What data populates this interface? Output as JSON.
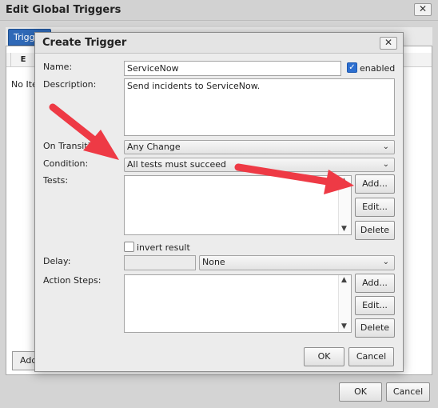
{
  "outer": {
    "title": "Edit Global Triggers",
    "tab_label": "Triggers",
    "column_header": "E",
    "empty_text": "No Items",
    "add_label": "Add",
    "ok_label": "OK",
    "cancel_label": "Cancel"
  },
  "dialog": {
    "title": "Create Trigger",
    "name_label": "Name:",
    "name_value": "ServiceNow",
    "enabled_label": "enabled",
    "enabled_checked": true,
    "description_label": "Description:",
    "description_value": "Send incidents to ServiceNow.",
    "on_transition_label": "On Transition:",
    "on_transition_value": "Any Change",
    "condition_label": "Condition:",
    "condition_value": "All tests must succeed",
    "tests_label": "Tests:",
    "tests_add": "Add...",
    "tests_edit": "Edit...",
    "tests_delete": "Delete",
    "invert_label": "invert result",
    "invert_checked": false,
    "delay_label": "Delay:",
    "delay_value": "",
    "delay_unit_value": "None",
    "action_steps_label": "Action Steps:",
    "actions_add": "Add...",
    "actions_edit": "Edit...",
    "actions_delete": "Delete",
    "ok_label": "OK",
    "cancel_label": "Cancel"
  },
  "icons": {
    "close": "close-icon",
    "chevron": "chevron-down-icon",
    "check": "check-icon"
  },
  "colors": {
    "tab_blue": "#2f69b7",
    "checkbox_blue": "#2d6fd0",
    "arrow_red": "#ee3a45"
  }
}
